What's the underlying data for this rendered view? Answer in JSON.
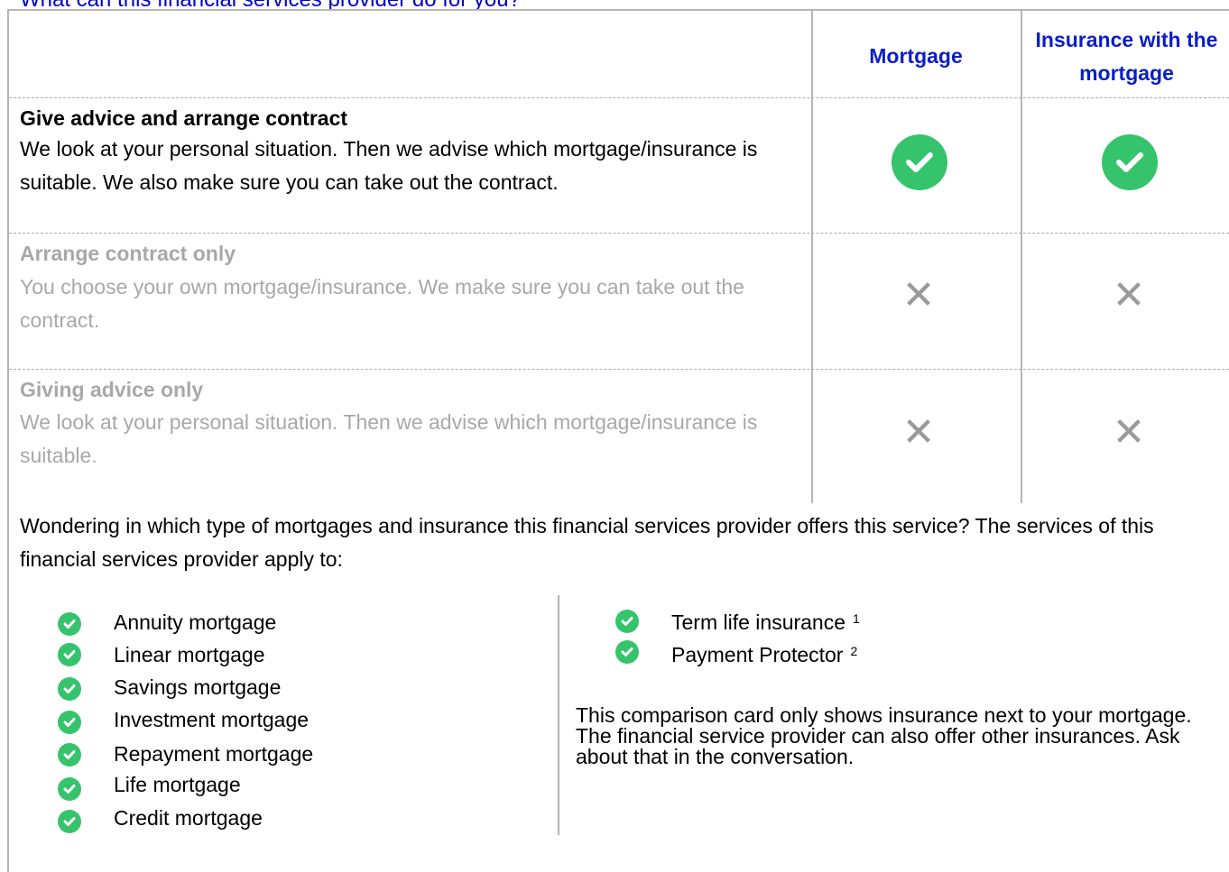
{
  "page": {
    "title": "What can this financial services provider do for you?"
  },
  "table": {
    "columns": [
      "Mortgage",
      "Insurance with the mortgage"
    ],
    "rows": [
      {
        "title": "Give advice and arrange contract",
        "description": "We look at your personal situation. Then we advise which mortgage/insurance is suitable. We also make sure you can take out the contract.",
        "mortgage": true,
        "insurance": true,
        "status_icon_mortgage": "check-circle-icon",
        "status_icon_insurance": "check-circle-icon"
      },
      {
        "title": "Arrange contract only",
        "description": "You choose your own mortgage/insurance. We make sure you can take out the contract.",
        "mortgage": false,
        "insurance": false,
        "status_icon_mortgage": "cross-icon",
        "status_icon_insurance": "cross-icon"
      },
      {
        "title": "Giving advice only",
        "description": "We look at your personal situation. Then we advise which mortgage/insurance is suitable.",
        "mortgage": false,
        "insurance": false,
        "status_icon_mortgage": "cross-icon",
        "status_icon_insurance": "cross-icon"
      }
    ]
  },
  "services": {
    "intro": "Wondering in which type of mortgages and insurance this financial services provider offers this service? The services of this financial services provider apply to:",
    "mortgages": [
      "Annuity mortgage",
      "Linear mortgage",
      "Savings mortgage",
      "Investment mortgage",
      "Repayment mortgage",
      "Life mortgage",
      "Credit mortgage"
    ],
    "insurances": [
      {
        "label": "Term life insurance",
        "footnote": "1"
      },
      {
        "label": "Payment Protector",
        "footnote": "2"
      }
    ],
    "note": "This comparison card only shows insurance next to your mortgage. The financial service provider can also offer other insurances. Ask about that in the conversation."
  },
  "colors": {
    "accent_blue": "#0a1fc4",
    "check_green": "#35c46b",
    "muted_text": "#a8a8a8",
    "cross_gray": "#9a9a9a"
  }
}
